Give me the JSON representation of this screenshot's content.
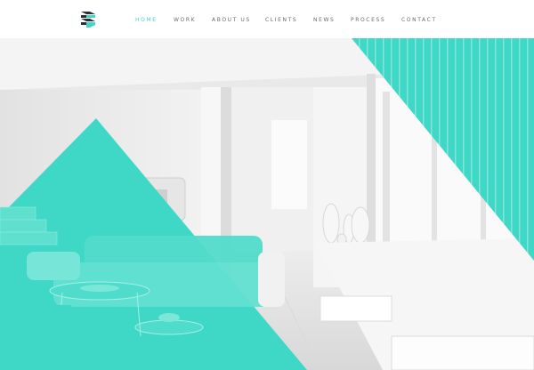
{
  "brand": {
    "logo_icon": "stacked-chevron-logo-icon"
  },
  "nav": {
    "items": [
      {
        "key": "home",
        "label": "HOME",
        "active": true
      },
      {
        "key": "work",
        "label": "WORK",
        "active": false
      },
      {
        "key": "about",
        "label": "ABOUT US",
        "active": false
      },
      {
        "key": "clients",
        "label": "CLIENTS",
        "active": false
      },
      {
        "key": "news",
        "label": "NEWS",
        "active": false
      },
      {
        "key": "process",
        "label": "PROCESS",
        "active": false
      },
      {
        "key": "contact",
        "label": "CONTACT",
        "active": false
      }
    ]
  },
  "theme": {
    "accent": "#3fd8c6",
    "nav_text": "#6b6b6b",
    "header_bg": "#ffffff"
  }
}
